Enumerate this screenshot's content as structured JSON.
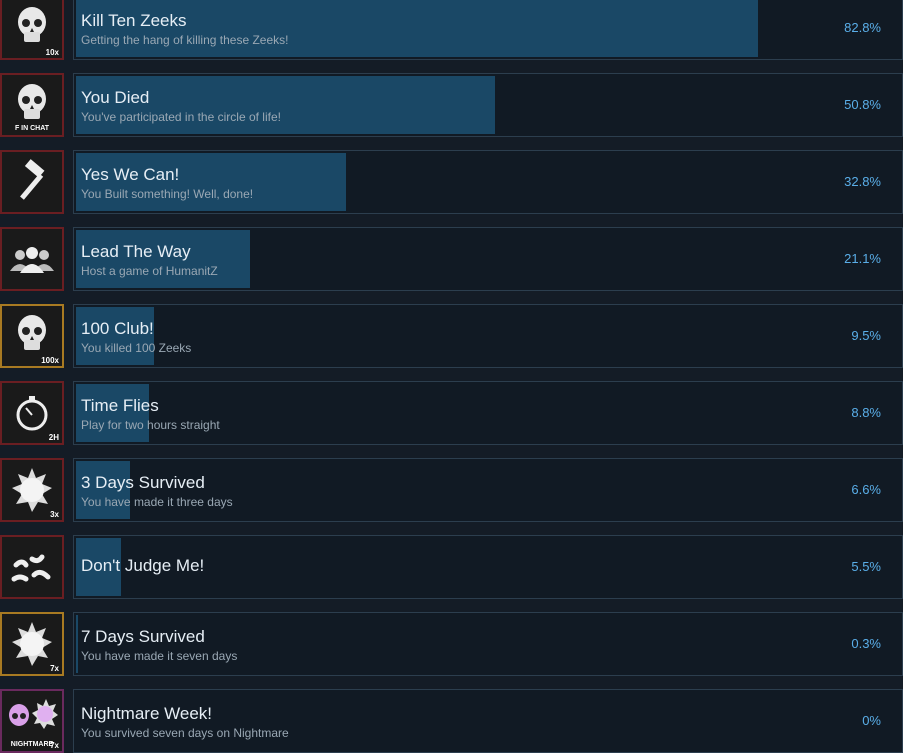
{
  "achievements": [
    {
      "title": "Kill Ten Zeeks",
      "description": "Getting the hang of killing these Zeeks!",
      "percent": 82.8,
      "percent_label": "82.8%",
      "icon": "skull-icon",
      "badge": "10x",
      "frame": "red"
    },
    {
      "title": "You Died",
      "description": "You've participated in the circle of life!",
      "percent": 50.8,
      "percent_label": "50.8%",
      "icon": "skull-icon",
      "badge": "F IN CHAT",
      "frame": "red"
    },
    {
      "title": "Yes We Can!",
      "description": "You Built something! Well, done!",
      "percent": 32.8,
      "percent_label": "32.8%",
      "icon": "hammer-icon",
      "badge": "",
      "frame": "red"
    },
    {
      "title": "Lead The Way",
      "description": "Host a game of HumanitZ",
      "percent": 21.1,
      "percent_label": "21.1%",
      "icon": "group-icon",
      "badge": "",
      "frame": "red"
    },
    {
      "title": "100 Club!",
      "description": "You killed 100 Zeeks",
      "percent": 9.5,
      "percent_label": "9.5%",
      "icon": "skull-icon",
      "badge": "100x",
      "frame": "gold"
    },
    {
      "title": "Time Flies",
      "description": "Play for two hours straight",
      "percent": 8.8,
      "percent_label": "8.8%",
      "icon": "stopwatch-icon",
      "badge": "2H",
      "frame": "red"
    },
    {
      "title": "3 Days Survived",
      "description": "You have made it three days",
      "percent": 6.6,
      "percent_label": "6.6%",
      "icon": "sun-icon",
      "badge": "3x",
      "frame": "red"
    },
    {
      "title": "Don't Judge Me!",
      "description": "",
      "percent": 5.5,
      "percent_label": "5.5%",
      "icon": "worms-icon",
      "badge": "",
      "frame": "red"
    },
    {
      "title": "7 Days Survived",
      "description": "You have made it seven days",
      "percent": 0.3,
      "percent_label": "0.3%",
      "icon": "sun-icon",
      "badge": "7x",
      "frame": "gold"
    },
    {
      "title": "Nightmare Week!",
      "description": "You survived seven days on Nightmare",
      "percent": 0,
      "percent_label": "0%",
      "icon": "nightmare-icon",
      "badge": "7x",
      "badge2": "NIGHTMARE",
      "frame": "purple"
    }
  ],
  "colors": {
    "fill": "#1a4866",
    "percent_text": "#5aaee8",
    "frame_red": "#6a1e22",
    "frame_gold": "#a87a22",
    "frame_purple": "#6a2a5e"
  }
}
